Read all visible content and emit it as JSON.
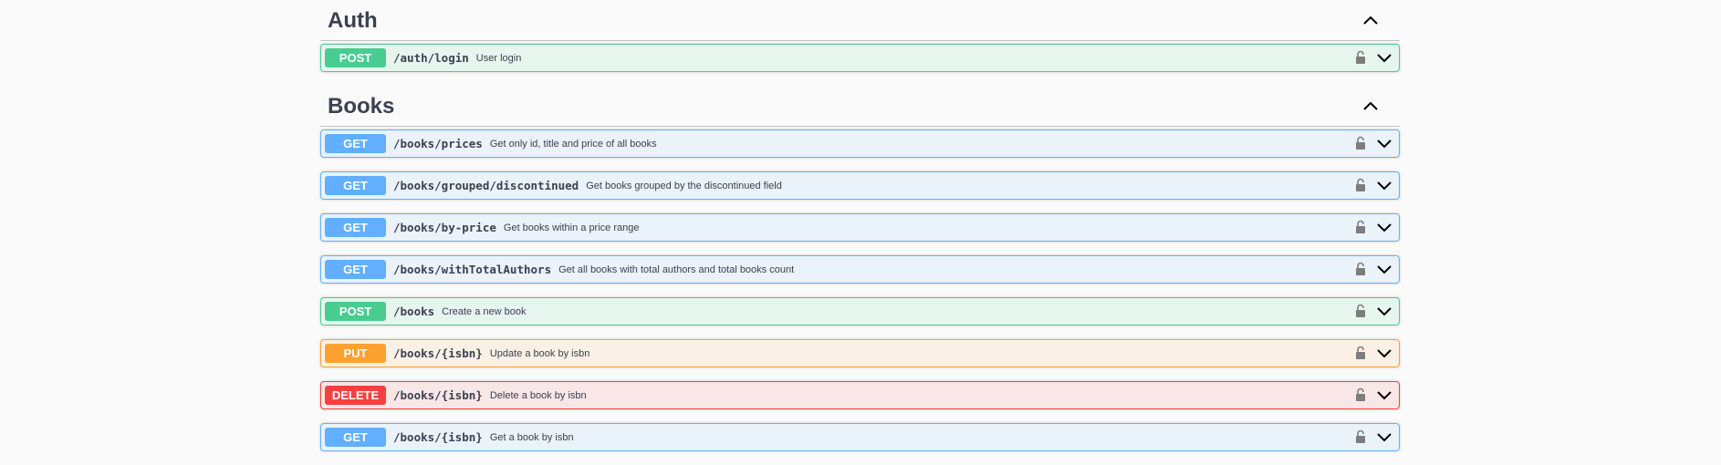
{
  "sections": [
    {
      "title": "Auth",
      "operations": [
        {
          "method": "POST",
          "path": "/auth/login",
          "summary": "User login"
        }
      ]
    },
    {
      "title": "Books",
      "operations": [
        {
          "method": "GET",
          "path": "/books/prices",
          "summary": "Get only id, title and price of all books"
        },
        {
          "method": "GET",
          "path": "/books/grouped/discontinued",
          "summary": "Get books grouped by the discontinued field"
        },
        {
          "method": "GET",
          "path": "/books/by-price",
          "summary": "Get books within a price range"
        },
        {
          "method": "GET",
          "path": "/books/withTotalAuthors",
          "summary": "Get all books with total authors and total books count"
        },
        {
          "method": "POST",
          "path": "/books",
          "summary": "Create a new book"
        },
        {
          "method": "PUT",
          "path": "/books/{isbn}",
          "summary": "Update a book by isbn"
        },
        {
          "method": "DELETE",
          "path": "/books/{isbn}",
          "summary": "Delete a book by isbn"
        },
        {
          "method": "GET",
          "path": "/books/{isbn}",
          "summary": "Get a book by isbn"
        }
      ]
    }
  ],
  "icons": {
    "collapse": "chevron-up-icon",
    "expand": "chevron-down-icon",
    "auth": "lock-icon"
  },
  "colors": {
    "get": "#61affe",
    "post": "#49cc90",
    "put": "#fca130",
    "delete": "#f93e3e"
  }
}
